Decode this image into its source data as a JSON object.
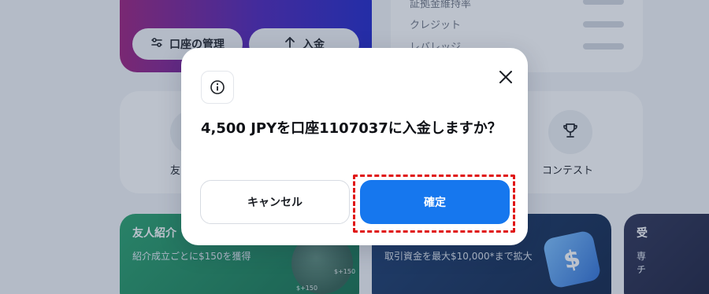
{
  "account": {
    "manage_label": "口座の管理",
    "deposit_label": "入金"
  },
  "account_info": {
    "rows": [
      "証拠金維持率",
      "クレジット",
      "レバレッジ"
    ]
  },
  "actions": {
    "friend_label": "友",
    "contest_label": "コンテスト"
  },
  "promos": {
    "referral": {
      "title": "友人紹介",
      "subtitle": "紹介成立ごとに$150を獲得",
      "tags": [
        "$+150",
        "$+150"
      ]
    },
    "funding": {
      "subtitle": "取引資金を最大$10,000*まで拡大",
      "cube_symbol": "$"
    },
    "third": {
      "title": "受",
      "subtitle_lines": [
        "専",
        "チ"
      ]
    }
  },
  "modal": {
    "title": "4,500 JPYを口座1107037に入金しますか？",
    "cancel_label": "キャンセル",
    "confirm_label": "確定",
    "icons": {
      "info": "info-icon",
      "close": "close-icon"
    }
  },
  "colors": {
    "accent": "#1677ee",
    "highlight": "#e01515",
    "overlay": "#344664"
  }
}
